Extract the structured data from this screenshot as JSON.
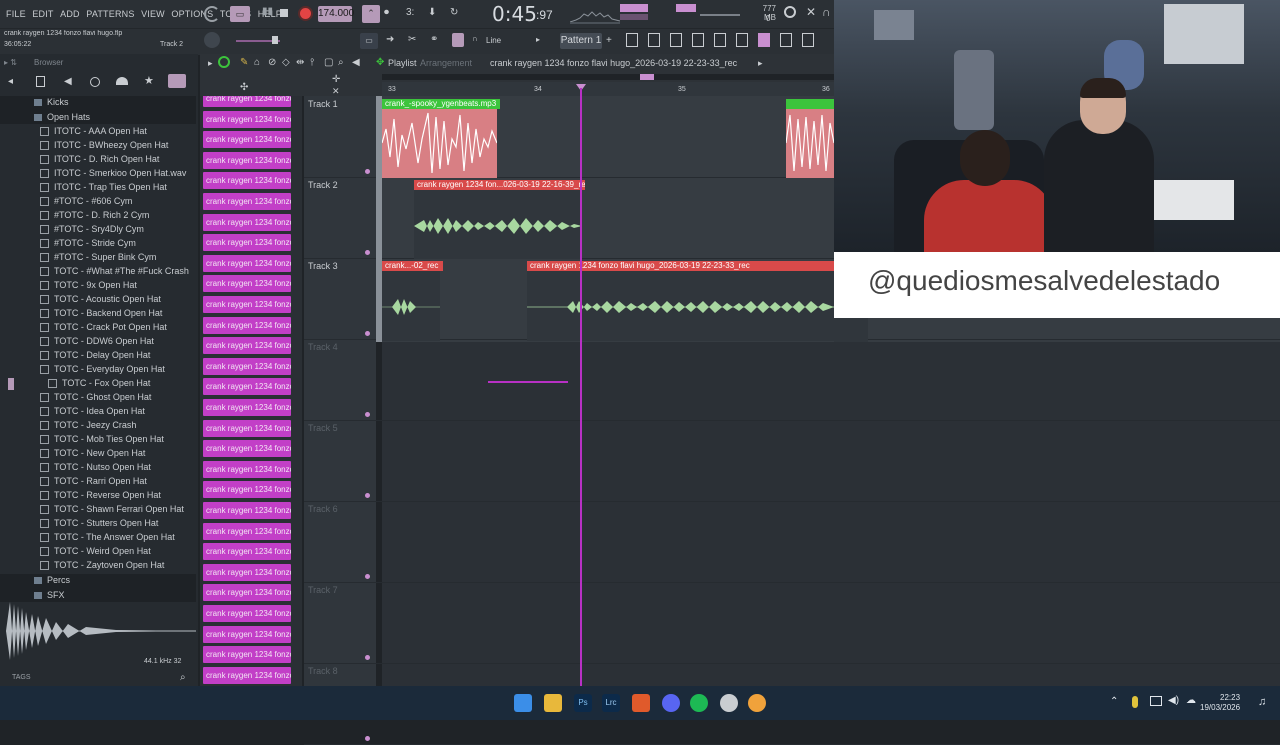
{
  "menu": [
    "FILE",
    "EDIT",
    "ADD",
    "PATTERNS",
    "VIEW",
    "OPTIONS",
    "TOOLS",
    "HELP"
  ],
  "transport": {
    "bpm": "174.000",
    "time": "0:45",
    "time_ms": ":97",
    "memory": "777 MB",
    "cpu": "0"
  },
  "hint": {
    "title": "crank raygen 1234 fonzo flavi hugo.flp",
    "position": "36:05:22",
    "track": "Track 2"
  },
  "toolbar2": {
    "snap": "Line",
    "pattern": "Pattern 1"
  },
  "browser": {
    "title": "Browser",
    "folders": {
      "kicks": "Kicks",
      "open_hats": "Open Hats",
      "percs": "Percs",
      "sfx": "SFX"
    },
    "items": [
      "ITOTC - AAA Open Hat",
      "ITOTC - BWheezy Open Hat",
      "ITOTC - D. Rich Open Hat",
      "ITOTC - Smerkioo Open Hat.wav",
      "ITOTC - Trap Ties Open Hat",
      "#TOTC - #606 Cym",
      "#TOTC - D. Rich 2 Cym",
      "#TOTC - Sry4Dly Cym",
      "#TOTC - Stride Cym",
      "#TOTC - Super Bink Cym",
      "TOTC - #What #The #Fuck Crash",
      "TOTC - 9x Open Hat",
      "TOTC - Acoustic Open Hat",
      "TOTC - Backend Open Hat",
      "TOTC - Crack Pot Open Hat",
      "TOTC - DDW6 Open Hat",
      "TOTC - Delay Open Hat",
      "TOTC - Everyday Open Hat",
      "TOTC - Fox Open Hat",
      "TOTC - Ghost Open Hat",
      "TOTC - Idea Open Hat",
      "TOTC - Jeezy Crash",
      "TOTC - Mob Ties Open Hat",
      "TOTC - New Open Hat",
      "TOTC - Nutso Open Hat",
      "TOTC - Rarri Open Hat",
      "TOTC - Reverse Open Hat",
      "TOTC - Shawn Ferrari Open Hat",
      "TOTC - Stutters Open Hat",
      "TOTC - The Answer Open Hat",
      "TOTC - Weird Open Hat",
      "TOTC - Zaytoven Open Hat"
    ],
    "sample_info": "44.1 kHz 32",
    "tags_label": "TAGS"
  },
  "channel_label": "crank raygen 1234 fonzo...",
  "playlist": {
    "title": "Playlist",
    "subtitle": "Arrangement",
    "pattern_name": "crank raygen 1234 fonzo flavi hugo_2026-03-19 22-23-33_rec",
    "ruler": [
      "33",
      "34",
      "35",
      "36"
    ],
    "tracks": [
      "Track 1",
      "Track 2",
      "Track 3",
      "Track 4",
      "Track 5",
      "Track 6",
      "Track 7",
      "Track 8"
    ],
    "clips": {
      "t1a": "crank_-spooky_ygenbeats.mp3",
      "t2a": "crank raygen 1234 fon...026-03-19 22-16-39_rec",
      "t3a": "crank...-02_rec",
      "t3b": "crank raygen 1234 fonzo flavi hugo_2026-03-19 22-23-33_rec"
    }
  },
  "overlay": {
    "handle": "@quediosmesalvedelestado"
  },
  "taskbar": {
    "time": "22:23",
    "date": "19/03/2026"
  },
  "colors": {
    "channel": "#c23fc7",
    "playhead": "#b830c5",
    "clip_red": "#d84a4a",
    "clip_green": "#3cc43c",
    "wave_green": "#a8d8a0"
  }
}
